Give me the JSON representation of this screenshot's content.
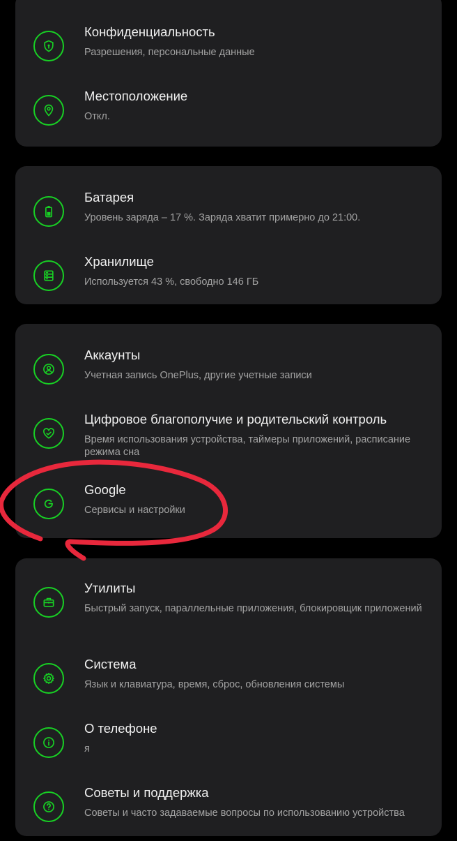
{
  "colors": {
    "background": "#000000",
    "card": "#1f1f21",
    "accent": "#18d024",
    "title": "#f0f0f0",
    "subtitle": "#a3a3a3",
    "annotation": "#e8283c"
  },
  "groups": [
    {
      "items": [
        {
          "icon": "shield-lock-icon",
          "title": "Конфиденциальность",
          "subtitle": "Разрешения, персональные данные"
        },
        {
          "icon": "location-pin-icon",
          "title": "Местоположение",
          "subtitle": "Откл."
        }
      ]
    },
    {
      "items": [
        {
          "icon": "battery-icon",
          "title": "Батарея",
          "subtitle": "Уровень заряда – 17 %. Заряда хватит примерно до 21:00."
        },
        {
          "icon": "storage-icon",
          "title": "Хранилище",
          "subtitle": "Используется 43 %, свободно 146 ГБ"
        }
      ]
    },
    {
      "items": [
        {
          "icon": "account-icon",
          "title": "Аккаунты",
          "subtitle": "Учетная запись OnePlus, другие учетные записи"
        },
        {
          "icon": "heart-icon",
          "title": "Цифровое благополучие и родительский контроль",
          "subtitle": "Время использования устройства, таймеры приложений, расписание режима сна"
        },
        {
          "icon": "google-icon",
          "title": "Google",
          "subtitle": "Сервисы и настройки"
        }
      ]
    },
    {
      "items": [
        {
          "icon": "toolbox-icon",
          "title": "Утилиты",
          "subtitle": "Быстрый запуск, параллельные приложения, блокировщик приложений"
        },
        {
          "icon": "gear-icon",
          "title": "Система",
          "subtitle": "Язык и клавиатура, время, сброс, обновления системы"
        },
        {
          "icon": "info-icon",
          "title": "О телефоне",
          "subtitle": "я"
        },
        {
          "icon": "help-icon",
          "title": "Советы и поддержка",
          "subtitle": "Советы и часто задаваемые вопросы по использованию устройства"
        }
      ]
    }
  ]
}
